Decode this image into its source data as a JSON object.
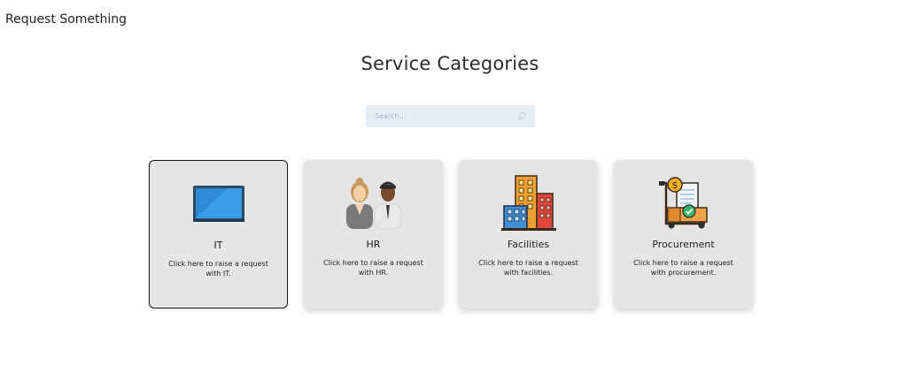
{
  "header": {
    "title": "Request Something"
  },
  "main": {
    "heading": "Service Categories",
    "search": {
      "placeholder": "Search..."
    }
  },
  "cards": [
    {
      "name": "IT",
      "description": "Click here to raise a request with IT.",
      "icon": "laptop-icon"
    },
    {
      "name": "HR",
      "description": "Click here to raise a request with HR.",
      "icon": "people-icon"
    },
    {
      "name": "Facilities",
      "description": "Click here to raise a request with facilities.",
      "icon": "buildings-icon"
    },
    {
      "name": "Procurement",
      "description": "Click here to raise a request with procurement.",
      "icon": "delivery-trolley-icon"
    }
  ],
  "colors": {
    "search_bg": "#e4ecf5",
    "card_bg": "#e5e5e5",
    "selected_border": "#1a1a1a"
  }
}
